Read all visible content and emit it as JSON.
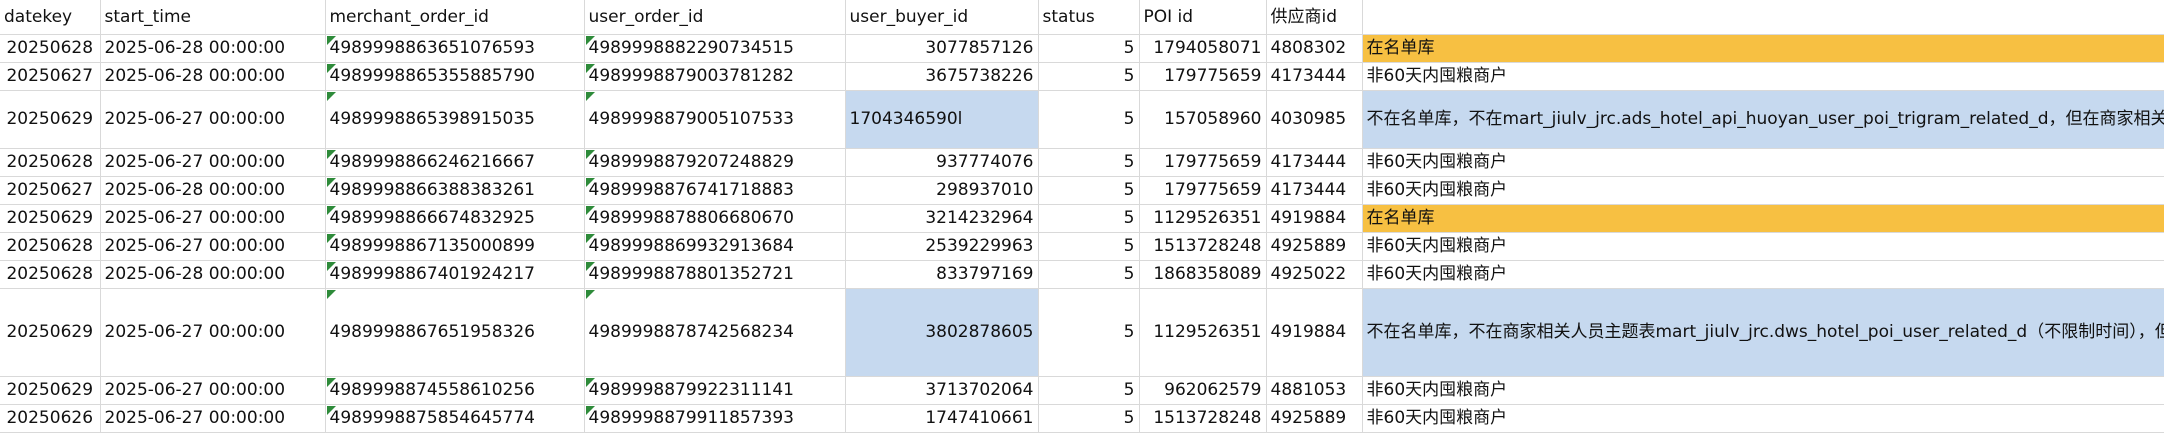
{
  "headers": [
    "datekey",
    "start_time",
    "merchant_order_id",
    "user_order_id",
    "user_buyer_id",
    "status",
    "POI id",
    "供应商id",
    ""
  ],
  "colors": {
    "highlight_orange": "#f7c042",
    "highlight_blue": "#c6d9ef",
    "flag_green": "#2e8b3a"
  },
  "rows": [
    {
      "datekey": "20250628",
      "start_time": "2025-06-28 00:00:00",
      "merchant_order_id": "4989998863651076593",
      "user_order_id": "4989998882290734515",
      "user_buyer_id": "3077857126",
      "status": "5",
      "poi_id": "1794058071",
      "supplier_id": "4808302",
      "note": "在名单库",
      "note_style": "orange",
      "buyer_style": "",
      "buyer_align": "right"
    },
    {
      "datekey": "20250627",
      "start_time": "2025-06-28 00:00:00",
      "merchant_order_id": "4989998865355885790",
      "user_order_id": "4989998879003781282",
      "user_buyer_id": "3675738226",
      "status": "5",
      "poi_id": "179775659",
      "supplier_id": "4173444",
      "note": "非60天内囤粮商户",
      "note_style": "",
      "buyer_style": "",
      "buyer_align": "right"
    },
    {
      "datekey": "20250629",
      "start_time": "2025-06-27 00:00:00",
      "merchant_order_id": "4989998865398915035",
      "user_order_id": "4989998879005107533",
      "user_buyer_id": "1704346590l",
      "status": "5",
      "poi_id": "157058960",
      "supplier_id": "4030985",
      "note": "不在名单库，不在mart_jiulv_jrc.ads_hotel_api_huoyan_user_poi_trigram_related_d，但在商家相关人员主题表---> inner join失败，因为关联的poi_id不相等",
      "note_style": "blue",
      "buyer_style": "blue",
      "buyer_align": "left"
    },
    {
      "datekey": "20250628",
      "start_time": "2025-06-27 00:00:00",
      "merchant_order_id": "4989998866246216667",
      "user_order_id": "4989998879207248829",
      "user_buyer_id": "937774076",
      "status": "5",
      "poi_id": "179775659",
      "supplier_id": "4173444",
      "note": "非60天内囤粮商户",
      "note_style": "",
      "buyer_style": "",
      "buyer_align": "right"
    },
    {
      "datekey": "20250627",
      "start_time": "2025-06-28 00:00:00",
      "merchant_order_id": "4989998866388383261",
      "user_order_id": "4989998876741718883",
      "user_buyer_id": "298937010",
      "status": "5",
      "poi_id": "179775659",
      "supplier_id": "4173444",
      "note": "非60天内囤粮商户",
      "note_style": "",
      "buyer_style": "",
      "buyer_align": "right"
    },
    {
      "datekey": "20250629",
      "start_time": "2025-06-27 00:00:00",
      "merchant_order_id": "4989998866674832925",
      "user_order_id": "4989998878806680670",
      "user_buyer_id": "3214232964",
      "status": "5",
      "poi_id": "1129526351",
      "supplier_id": "4919884",
      "note": "在名单库",
      "note_style": "orange",
      "buyer_style": "",
      "buyer_align": "right"
    },
    {
      "datekey": "20250628",
      "start_time": "2025-06-27 00:00:00",
      "merchant_order_id": "4989998867135000899",
      "user_order_id": "4989998869932913684",
      "user_buyer_id": "2539229963",
      "status": "5",
      "poi_id": "1513728248",
      "supplier_id": "4925889",
      "note": "非60天内囤粮商户",
      "note_style": "",
      "buyer_style": "",
      "buyer_align": "right"
    },
    {
      "datekey": "20250628",
      "start_time": "2025-06-28 00:00:00",
      "merchant_order_id": "4989998867401924217",
      "user_order_id": "4989998878801352721",
      "user_buyer_id": "833797169",
      "status": "5",
      "poi_id": "1868358089",
      "supplier_id": "4925022",
      "note": "非60天内囤粮商户",
      "note_style": "",
      "buyer_style": "",
      "buyer_align": "right"
    },
    {
      "datekey": "20250629",
      "start_time": "2025-06-27 00:00:00",
      "merchant_order_id": "4989998867651958326",
      "user_order_id": "4989998878742568234",
      "user_buyer_id": "3802878605",
      "status": "5",
      "poi_id": "1129526351",
      "supplier_id": "4919884",
      "note": "不在名单库，不在商家相关人员主题表mart_jiulv_jrc.dws_hotel_poi_user_related_d（不限制时间），但是在mart_jiulv_jrc.ads_hotel_api_huoyan_user_poi_trigram_related_d-->inner join 失败，因为在poi_trigram_related_d中poi_id的存储格式如图",
      "note_style": "blue",
      "buyer_style": "blue",
      "buyer_align": "right"
    },
    {
      "datekey": "20250629",
      "start_time": "2025-06-27 00:00:00",
      "merchant_order_id": "4989998874558610256",
      "user_order_id": "4989998879922311141",
      "user_buyer_id": "3713702064",
      "status": "5",
      "poi_id": "962062579",
      "supplier_id": "4881053",
      "note": "非60天内囤粮商户",
      "note_style": "",
      "buyer_style": "",
      "buyer_align": "right"
    },
    {
      "datekey": "20250626",
      "start_time": "2025-06-27 00:00:00",
      "merchant_order_id": "4989998875854645774",
      "user_order_id": "4989998879911857393",
      "user_buyer_id": "1747410661",
      "status": "5",
      "poi_id": "1513728248",
      "supplier_id": "4925889",
      "note": "非60天内囤粮商户",
      "note_style": "",
      "buyer_style": "",
      "buyer_align": "right"
    }
  ]
}
